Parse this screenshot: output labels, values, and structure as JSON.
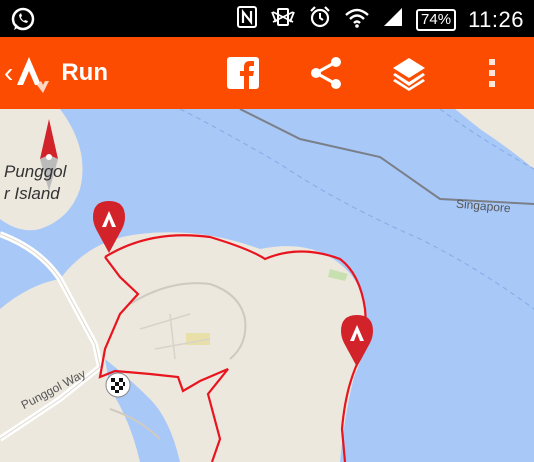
{
  "status_bar": {
    "icons": [
      "whatsapp-icon",
      "nfc-icon",
      "vibrate-icon",
      "alarm-icon",
      "wifi-icon",
      "signal-icon"
    ],
    "battery": "74%",
    "time": "11:26"
  },
  "app_bar": {
    "title": "Run",
    "actions": [
      "facebook-icon",
      "share-icon",
      "layers-icon",
      "overflow-menu-icon"
    ],
    "color": "#fc4c02"
  },
  "map": {
    "labels": {
      "island_line1": "Punggol",
      "island_line2": "r Island",
      "road": "Punggol Way",
      "country": "Singapore"
    },
    "route_color": "#e8141e",
    "water_color": "#a8c8f8",
    "land_color": "#ece8de",
    "markers": [
      "strava-marker-icon",
      "strava-marker-icon",
      "finish-flag-icon"
    ],
    "compass": "compass-icon"
  }
}
